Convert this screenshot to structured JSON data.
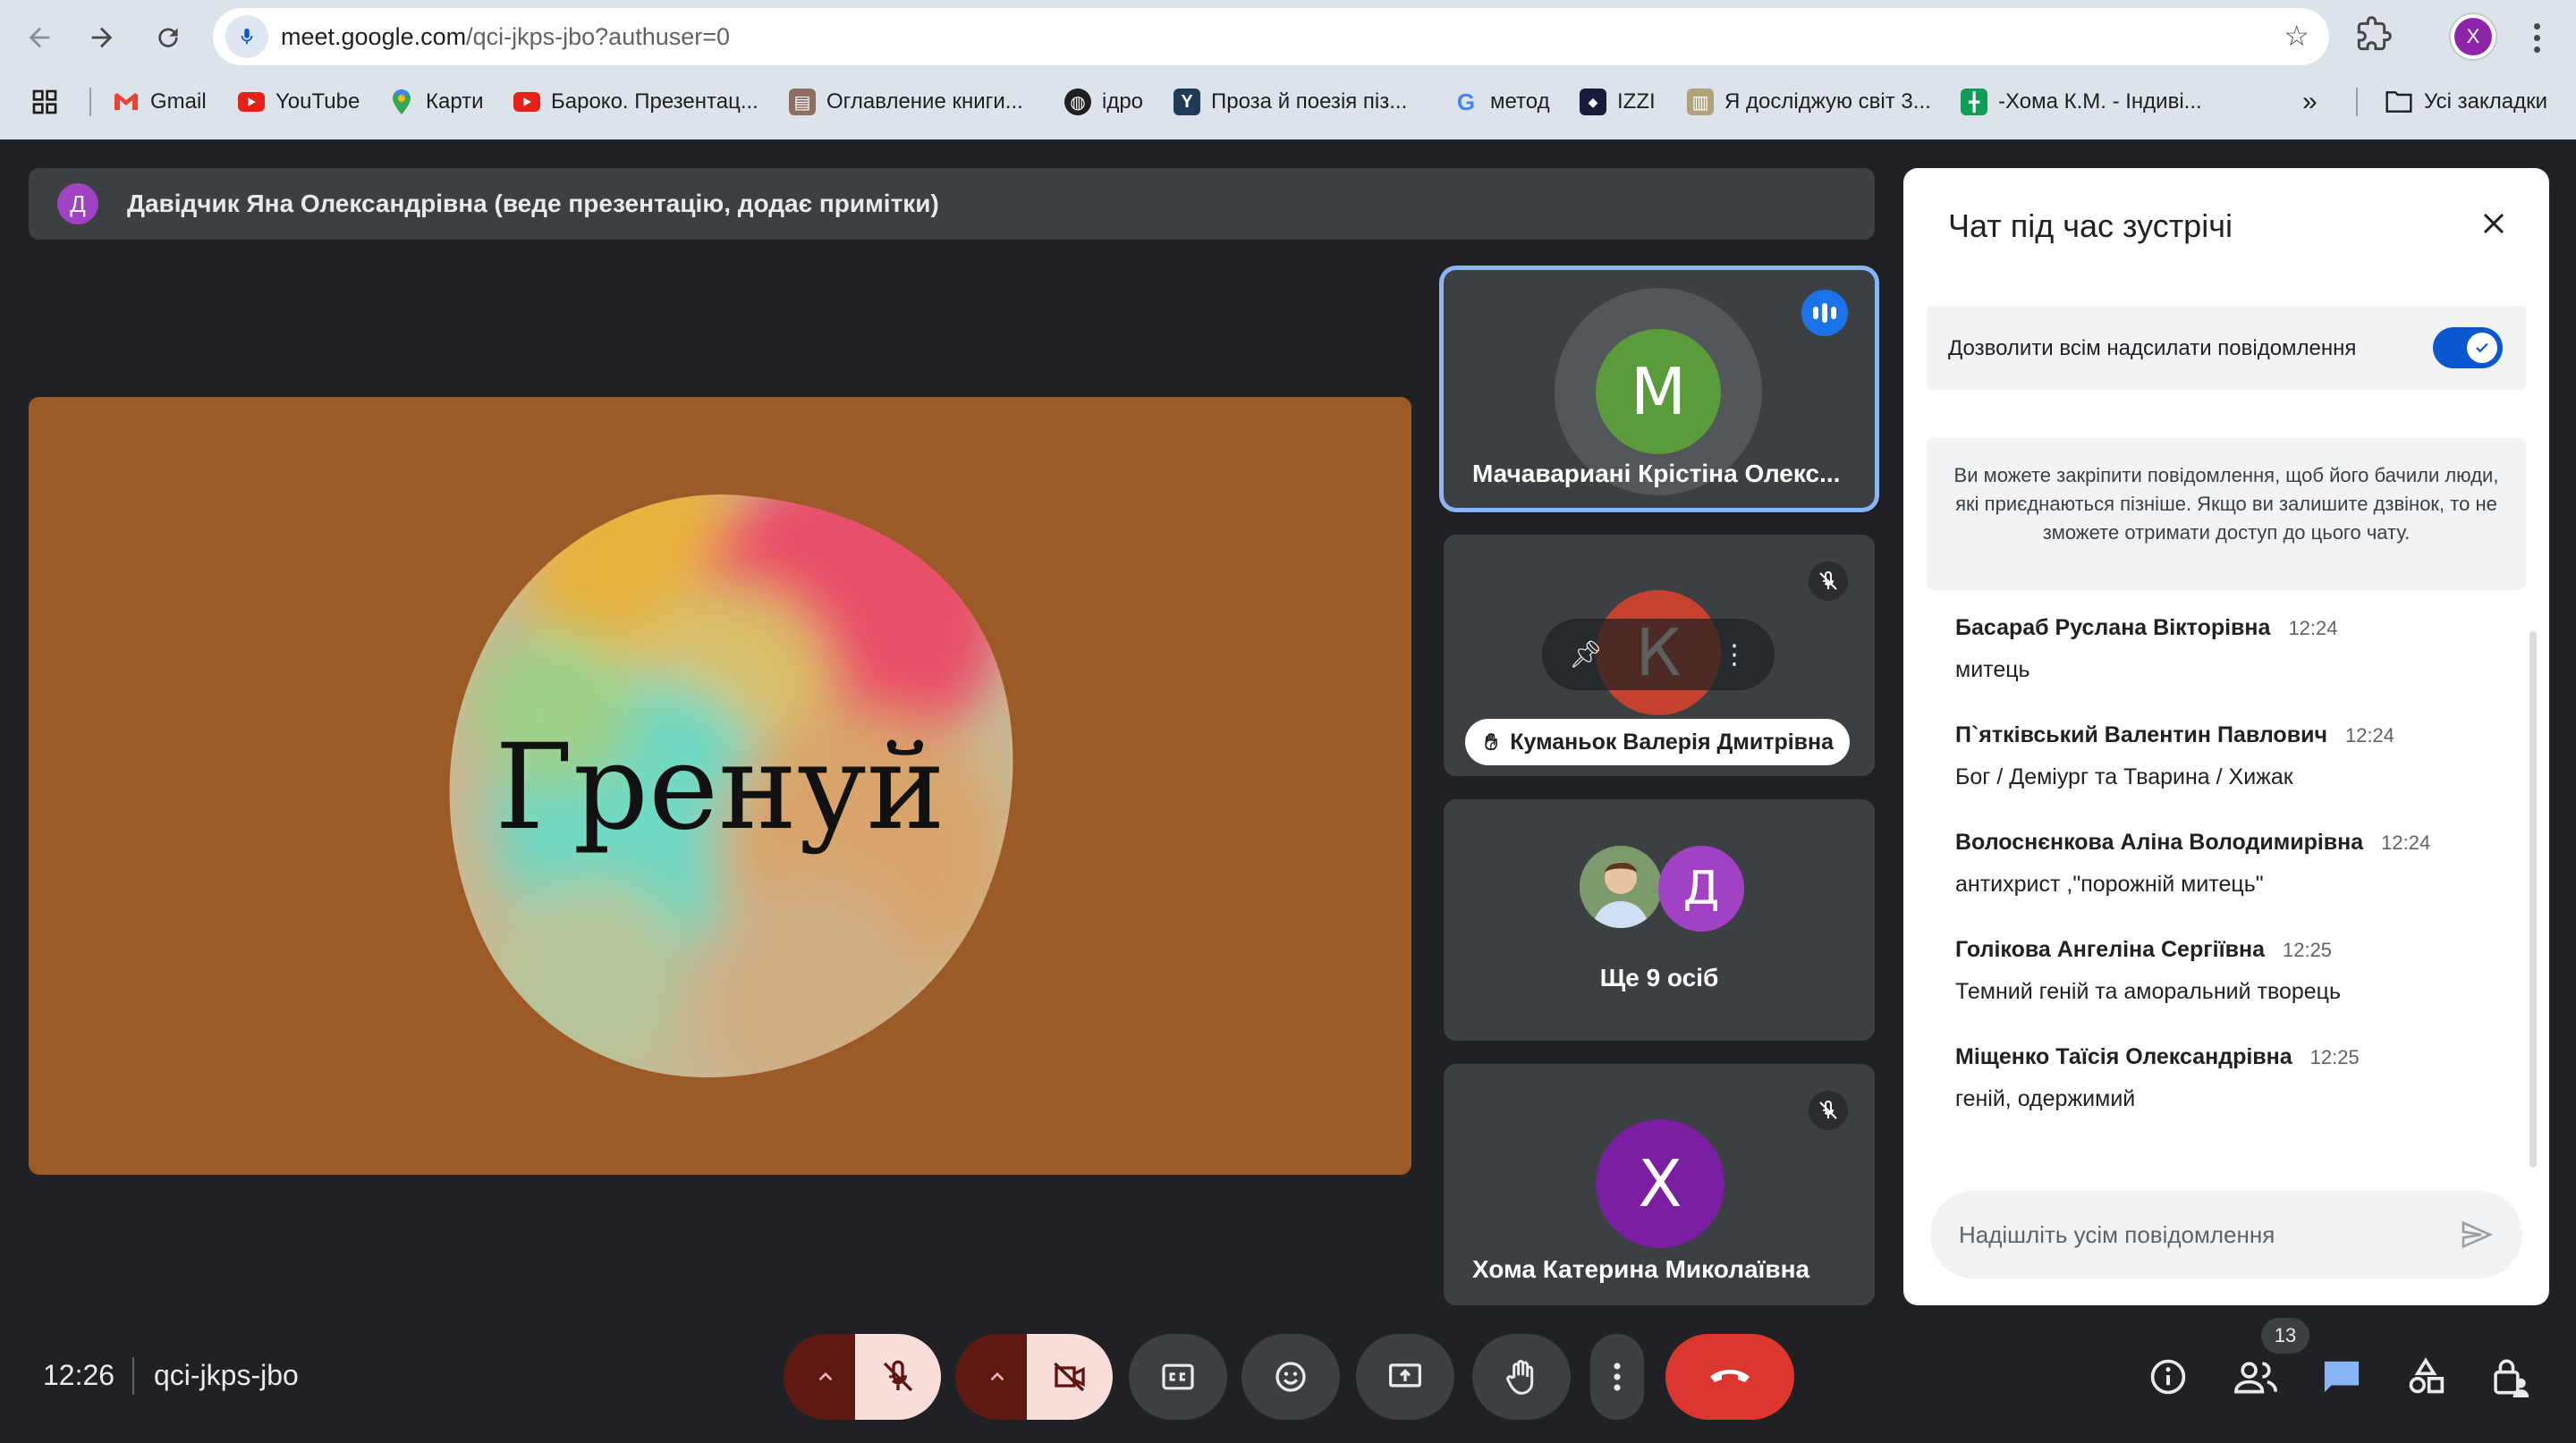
{
  "browser": {
    "url_host": "meet.google.com",
    "url_path": "/qci-jkps-jbo?authuser=0",
    "profile_initial": "X",
    "bookmarks": [
      {
        "label": "Gmail",
        "icon": "gmail-icon"
      },
      {
        "label": "YouTube",
        "icon": "youtube-icon"
      },
      {
        "label": "Карти",
        "icon": "maps-icon"
      },
      {
        "label": "Бароко. Презентац...",
        "icon": "youtube-icon"
      },
      {
        "label": "Оглавление книги...",
        "icon": "book-icon"
      },
      {
        "label": "ідро",
        "icon": "globe-icon"
      },
      {
        "label": "Проза й поезія піз...",
        "icon": "y-icon"
      },
      {
        "label": "метод",
        "icon": "google-icon"
      },
      {
        "label": "IZZI",
        "icon": "izzi-icon"
      },
      {
        "label": "Я досліджую світ 3...",
        "icon": "book-icon"
      },
      {
        "label": "-Хома К.М. - Індиві...",
        "icon": "sheets-icon"
      }
    ],
    "more_bookmarks": "»",
    "all_bookmarks": "Усі закладки"
  },
  "meet": {
    "presenter": {
      "initial": "Д",
      "text": "Давідчик Яна Олександрівна (веде презентацію, додає примітки)"
    },
    "slide_text": "Гренуй",
    "tiles": [
      {
        "initial": "М",
        "name": "Мачавариані Крістіна Олекс...",
        "speaking": true
      },
      {
        "initial": "К",
        "name": "Куманьок Валерія Дмитрівна",
        "hand_raised": true,
        "muted": true
      },
      {
        "initial": "Д",
        "name": "Ще 9 осіб"
      },
      {
        "initial": "Х",
        "name": "Хома Катерина Миколаївна",
        "muted": true
      }
    ],
    "clock": "12:26",
    "meeting_code": "qci-jkps-jbo",
    "participant_count": "13"
  },
  "chat": {
    "title": "Чат під час зустрічі",
    "allow_label": "Дозволити всім надсилати повідомлення",
    "allow_enabled": true,
    "pin_note": "Ви можете закріпити повідомлення, щоб його бачили люди, які приєднаються пізніше. Якщо ви залишите дзвінок, то не зможете отримати доступ до цього чату.",
    "messages": [
      {
        "sender": "Басараб Руслана Вікторівна",
        "time": "12:24",
        "text": "митець"
      },
      {
        "sender": "П`ятківський Валентин Павлович",
        "time": "12:24",
        "text": "Бог / Деміург та Тварина / Хижак"
      },
      {
        "sender": "Волоснєнкова Аліна Володимирівна",
        "time": "12:24",
        "text": "антихрист ,\"порожній митець\""
      },
      {
        "sender": "Голікова Ангеліна Сергіївна",
        "time": "12:25",
        "text": "Темний геній та аморальний творець"
      },
      {
        "sender": "Міщенко Таїсія Олександрівна",
        "time": "12:25",
        "text": "геній, одержимий"
      }
    ],
    "input_placeholder": "Надішліть усім повідомлення"
  },
  "colors": {
    "meet_bg": "#202124",
    "tile_bg": "#3c4043",
    "accent_blue": "#0b57d0",
    "hangup_red": "#dc362e",
    "slide_bg": "#9c5a27"
  }
}
